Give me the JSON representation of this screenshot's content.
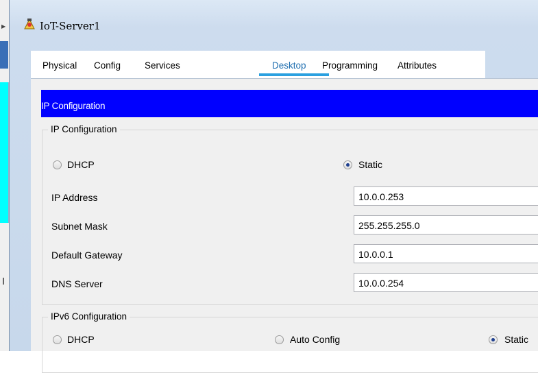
{
  "window": {
    "title": "IoT-Server1"
  },
  "tabs": [
    {
      "label": "Physical"
    },
    {
      "label": "Config"
    },
    {
      "label": "Services"
    },
    {
      "label": "Desktop",
      "active": true
    },
    {
      "label": "Programming"
    },
    {
      "label": "Attributes"
    }
  ],
  "ip_config": {
    "header": "IP Configuration",
    "group_title": "IP Configuration",
    "mode_dhcp": "DHCP",
    "mode_static": "Static",
    "selected_mode": "Static",
    "fields": {
      "ip_address": {
        "label": "IP Address",
        "value": "10.0.0.253"
      },
      "subnet_mask": {
        "label": "Subnet Mask",
        "value": "255.255.255.0"
      },
      "default_gateway": {
        "label": "Default Gateway",
        "value": "10.0.0.1"
      },
      "dns_server": {
        "label": "DNS Server",
        "value": "10.0.0.254"
      }
    }
  },
  "ipv6_config": {
    "group_title": "IPv6 Configuration",
    "mode_dhcp": "DHCP",
    "mode_auto": "Auto Config",
    "mode_static": "Static",
    "selected_mode": "Static"
  },
  "colors": {
    "header_bar": "#0000ff",
    "active_tab": "#1f6fb0",
    "tab_underline": "#2aa0e0"
  }
}
